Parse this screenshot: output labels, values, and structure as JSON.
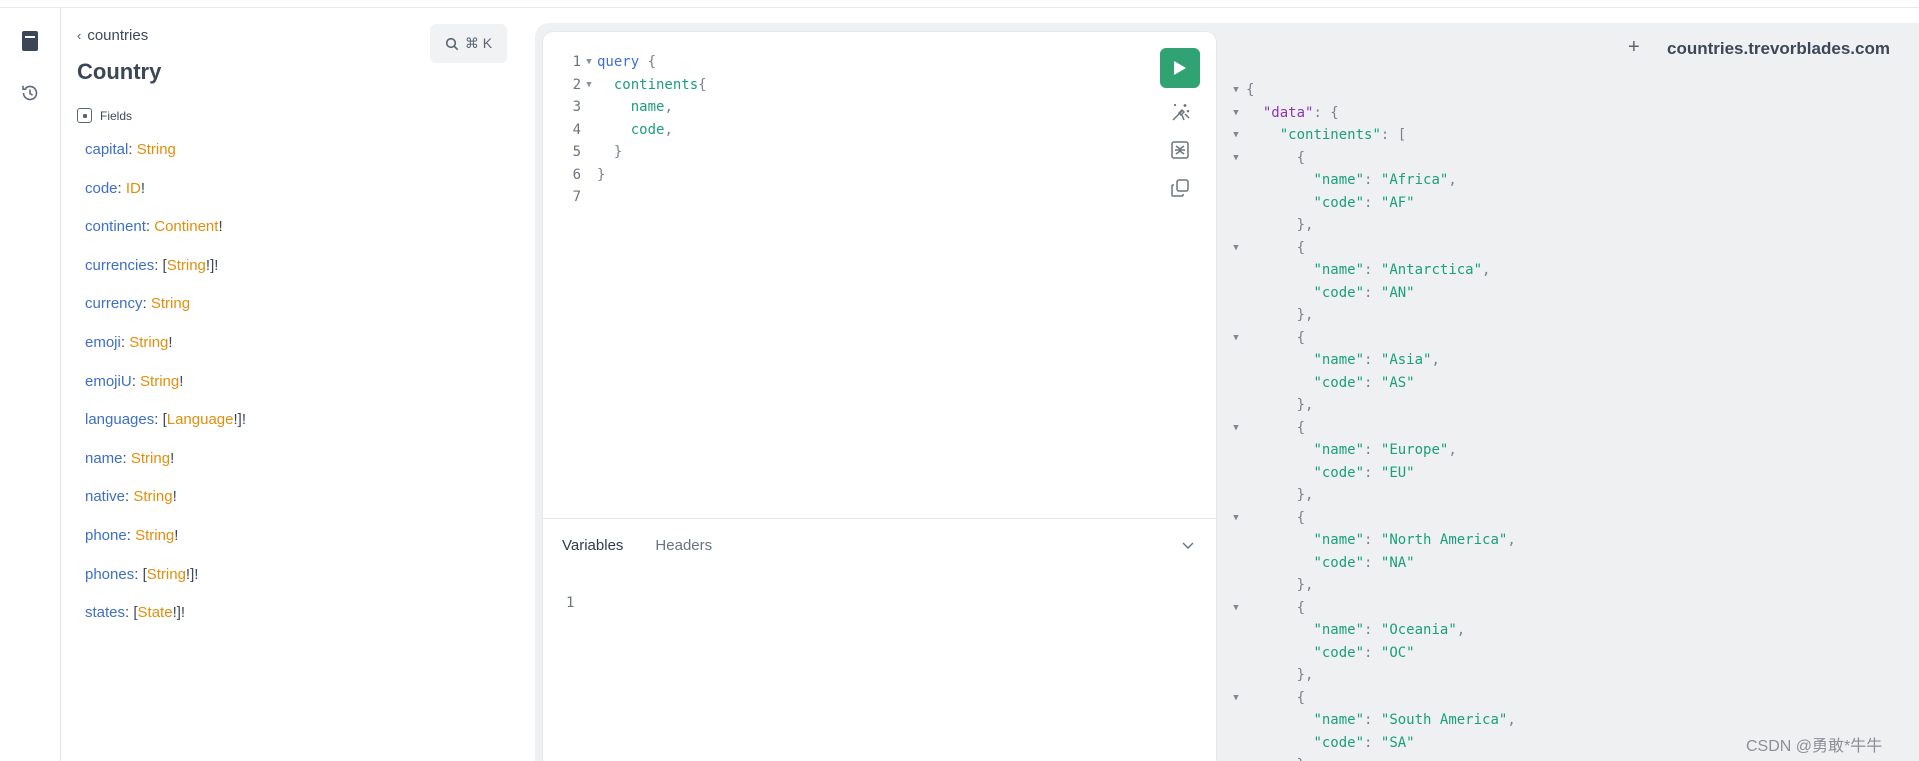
{
  "header": {
    "endpoint": "countries.trevorblades.com",
    "add_tab_glyph": "+"
  },
  "rail": {
    "icons": [
      "docs-book-icon",
      "history-icon"
    ]
  },
  "docs": {
    "back_label": "countries",
    "title": "Country",
    "search_shortcut": "⌘ K",
    "fields_label": "Fields",
    "fields": [
      {
        "name": "capital",
        "pre": "",
        "type": "String",
        "post": ""
      },
      {
        "name": "code",
        "pre": "",
        "type": "ID",
        "post": "!"
      },
      {
        "name": "continent",
        "pre": "",
        "type": "Continent",
        "post": "!"
      },
      {
        "name": "currencies",
        "pre": "[",
        "type": "String",
        "post": "!]!"
      },
      {
        "name": "currency",
        "pre": "",
        "type": "String",
        "post": ""
      },
      {
        "name": "emoji",
        "pre": "",
        "type": "String",
        "post": "!"
      },
      {
        "name": "emojiU",
        "pre": "",
        "type": "String",
        "post": "!"
      },
      {
        "name": "languages",
        "pre": "[",
        "type": "Language",
        "post": "!]!"
      },
      {
        "name": "name",
        "pre": "",
        "type": "String",
        "post": "!"
      },
      {
        "name": "native",
        "pre": "",
        "type": "String",
        "post": "!"
      },
      {
        "name": "phone",
        "pre": "",
        "type": "String",
        "post": "!"
      },
      {
        "name": "phones",
        "pre": "[",
        "type": "String",
        "post": "!]!"
      },
      {
        "name": "states",
        "pre": "[",
        "type": "State",
        "post": "!]!"
      }
    ]
  },
  "editor": {
    "lines": [
      {
        "n": "1",
        "fold": true,
        "indent": "",
        "tokens": [
          {
            "t": "query",
            "c": "kw"
          },
          {
            "t": " {",
            "c": "punc"
          }
        ]
      },
      {
        "n": "2",
        "fold": true,
        "indent": "  ",
        "tokens": [
          {
            "t": "continents",
            "c": "fld"
          },
          {
            "t": "{",
            "c": "punc"
          }
        ]
      },
      {
        "n": "3",
        "fold": false,
        "indent": "    ",
        "tokens": [
          {
            "t": "name",
            "c": "fld"
          },
          {
            "t": ",",
            "c": "punc"
          }
        ]
      },
      {
        "n": "4",
        "fold": false,
        "indent": "    ",
        "tokens": [
          {
            "t": "code",
            "c": "fld"
          },
          {
            "t": ",",
            "c": "punc"
          }
        ]
      },
      {
        "n": "5",
        "fold": false,
        "indent": "  ",
        "tokens": [
          {
            "t": "}",
            "c": "punc"
          }
        ]
      },
      {
        "n": "6",
        "fold": false,
        "indent": "",
        "tokens": [
          {
            "t": "}",
            "c": "punc"
          }
        ]
      },
      {
        "n": "7",
        "fold": false,
        "indent": "",
        "tokens": []
      }
    ],
    "tools": [
      "run-icon",
      "prettify-icon",
      "merge-fragments-icon",
      "copy-icon"
    ]
  },
  "bottom_panel": {
    "tabs": [
      "Variables",
      "Headers"
    ],
    "active_tab": "Variables",
    "variables_line_number": "1"
  },
  "result": {
    "root_key": "data",
    "list_key": "continents",
    "continents": [
      {
        "name": "Africa",
        "code": "AF"
      },
      {
        "name": "Antarctica",
        "code": "AN"
      },
      {
        "name": "Asia",
        "code": "AS"
      },
      {
        "name": "Europe",
        "code": "EU"
      },
      {
        "name": "North America",
        "code": "NA"
      },
      {
        "name": "Oceania",
        "code": "OC"
      },
      {
        "name": "South America",
        "code": "SA"
      }
    ]
  },
  "watermark": "CSDN @勇敢*牛牛",
  "colors": {
    "run_button": "#31a372",
    "field_name": "#3c6fc6",
    "type_name": "#e38e0b",
    "json_string": "#1aa07a",
    "json_root_key": "#8b34b8"
  }
}
